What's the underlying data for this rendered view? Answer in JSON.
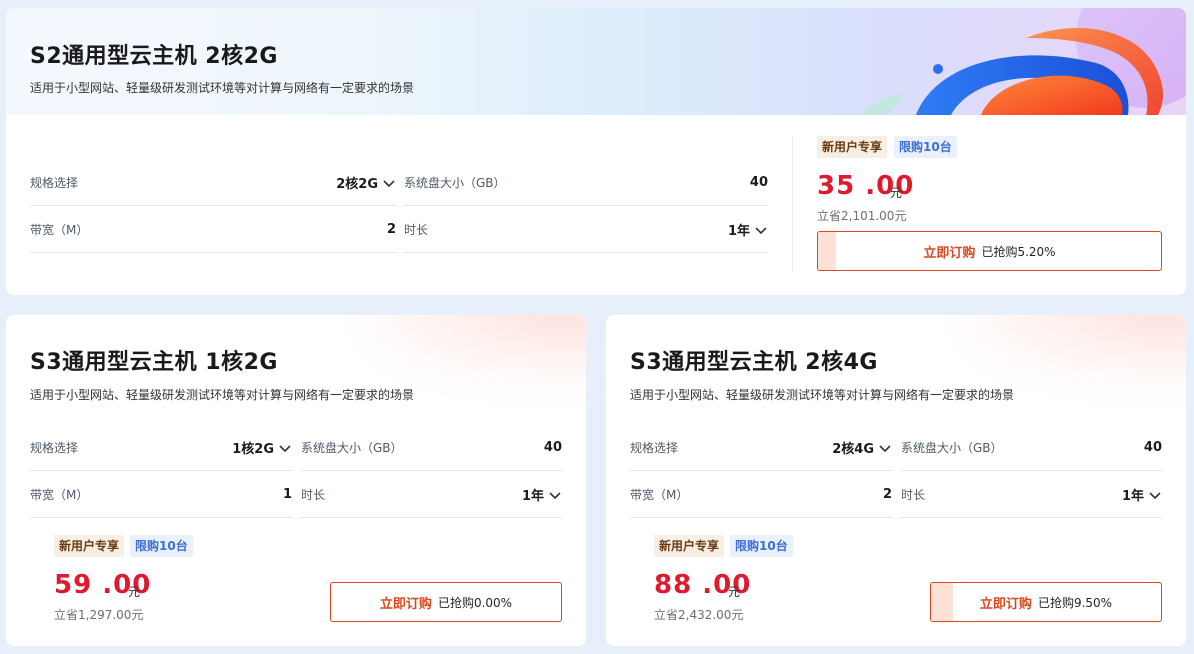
{
  "cards": [
    {
      "title": "S2通用型云主机 2核2G",
      "subtitle": "适用于小型网站、轻量级研发测试环境等对计算与网络有一定要求的场景",
      "spec_label": "规格选择",
      "spec_value": "2核2G",
      "disk_label": "系统盘大小（GB）",
      "disk_value": "40",
      "bw_label": "带宽（M）",
      "bw_value": "2",
      "dur_label": "时长",
      "dur_value": "1年",
      "tag_new": "新用户专享",
      "tag_limit": "限购10台",
      "price": "35 .00",
      "unit": "元",
      "saving": "立省2,101.00元",
      "buy_label": "立即订购",
      "sold_text": "已抢购5.20%",
      "sold_fraction": 0.052
    },
    {
      "title": "S3通用型云主机 1核2G",
      "subtitle": "适用于小型网站、轻量级研发测试环境等对计算与网络有一定要求的场景",
      "spec_label": "规格选择",
      "spec_value": "1核2G",
      "disk_label": "系统盘大小（GB）",
      "disk_value": "40",
      "bw_label": "带宽（M）",
      "bw_value": "1",
      "dur_label": "时长",
      "dur_value": "1年",
      "tag_new": "新用户专享",
      "tag_limit": "限购10台",
      "price": "59 .00",
      "unit": "元",
      "saving": "立省1,297.00元",
      "buy_label": "立即订购",
      "sold_text": "已抢购0.00%",
      "sold_fraction": 0.0
    },
    {
      "title": "S3通用型云主机 2核4G",
      "subtitle": "适用于小型网站、轻量级研发测试环境等对计算与网络有一定要求的场景",
      "spec_label": "规格选择",
      "spec_value": "2核4G",
      "disk_label": "系统盘大小（GB）",
      "disk_value": "40",
      "bw_label": "带宽（M）",
      "bw_value": "2",
      "dur_label": "时长",
      "dur_value": "1年",
      "tag_new": "新用户专享",
      "tag_limit": "限购10台",
      "price": "88 .00",
      "unit": "元",
      "saving": "立省2,432.00元",
      "buy_label": "立即订购",
      "sold_text": "已抢购9.50%",
      "sold_fraction": 0.095
    }
  ],
  "colors": {
    "price": "#e0192f",
    "buy_border": "#d9481d",
    "buy_fill": "#fde0d6",
    "tag_new_bg": "#f6efe5",
    "tag_limit_bg": "#eaf1fd"
  },
  "icons": {
    "dropdown": "chevron-down-icon"
  }
}
